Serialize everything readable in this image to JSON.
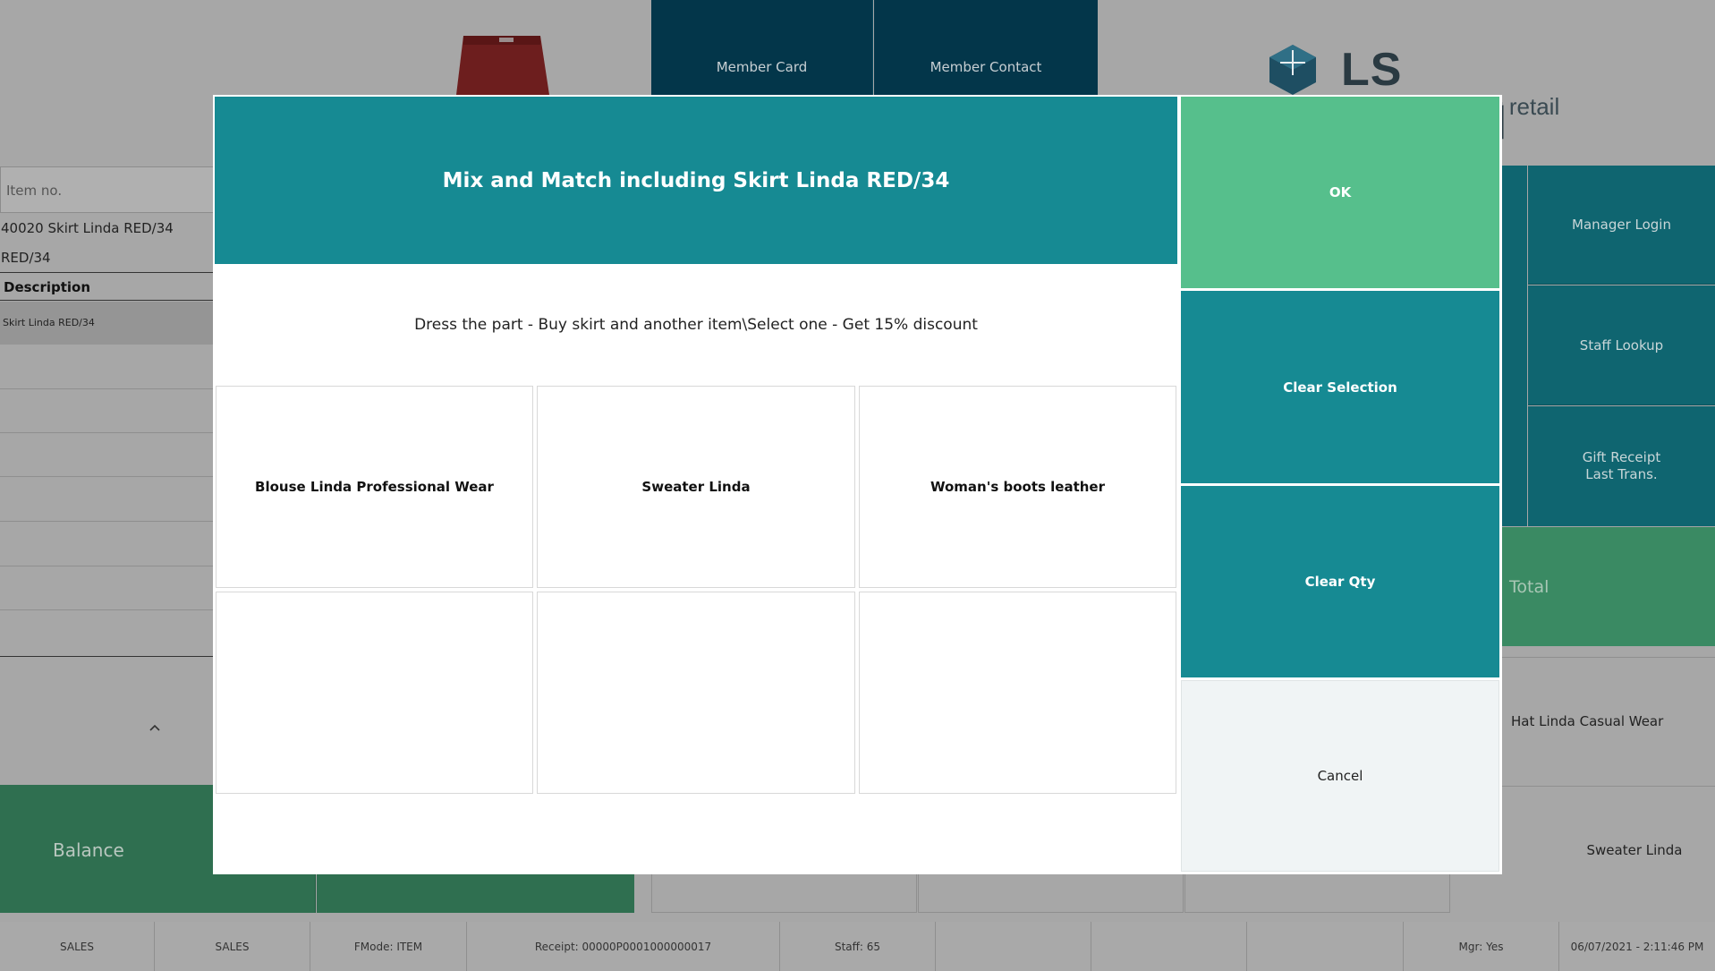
{
  "background": {
    "top_buttons": [
      "Member Card",
      "Member Contact"
    ],
    "logo": {
      "brand": "LS Central",
      "tagline": "r retail"
    },
    "item_input_placeholder": "Item no.",
    "item_line1": "40020 Skirt Linda RED/34",
    "item_line2": "RED/34",
    "desc_header": "Description",
    "desc_row": "Skirt Linda RED/34",
    "right_buttons": [
      "Manager Login",
      "Staff Lookup",
      "Gift Receipt\nLast Trans."
    ],
    "total_label": "Total",
    "balance_label": "Balance",
    "bottom_right_items": [
      "Hat Linda Casual Wear",
      "Sweater Linda"
    ]
  },
  "statusbar": [
    "SALES",
    "SALES",
    "FMode: ITEM",
    "Receipt: 00000P0001000000017",
    "Staff: 65",
    "",
    "",
    "",
    "Mgr: Yes",
    "06/07/2021 - 2:11:46 PM"
  ],
  "dialog": {
    "title": "Mix and Match including Skirt Linda RED/34",
    "description": "Dress the part - Buy skirt and another item\\Select one - Get 15% discount",
    "options": [
      "Blouse Linda Professional Wear",
      "Sweater Linda",
      "Woman's boots leather",
      "",
      "",
      ""
    ],
    "buttons": {
      "ok": "OK",
      "clear_selection": "Clear Selection",
      "clear_qty": "Clear Qty",
      "cancel": "Cancel"
    }
  },
  "colors": {
    "header": "#168a93",
    "ok": "#56bf8c",
    "action": "#168a93",
    "cancel": "#f0f4f5"
  }
}
